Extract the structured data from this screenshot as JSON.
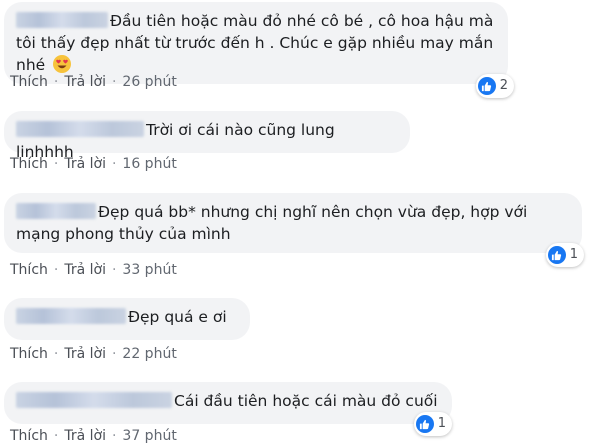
{
  "comments": [
    {
      "text": "Đầu tiên hoặc màu đỏ nhé cô bé , cô hoa hậu mà tôi thấy đẹp nhất từ trước đến h . Chúc e gặp nhiều may mắn nhé",
      "emoji": "heart-eyes-emoji",
      "like_label": "Thích",
      "reply_label": "Trả lời",
      "time": "26 phút",
      "reaction_count": "2"
    },
    {
      "text": "Trời ơi cái nào cũng lung linhhhh",
      "like_label": "Thích",
      "reply_label": "Trả lời",
      "time": "16 phút"
    },
    {
      "text": "Đẹp quá bb* nhưng chị nghĩ nên chọn vừa đẹp, hợp với mạng phong thủy của mình",
      "like_label": "Thích",
      "reply_label": "Trả lời",
      "time": "33 phút",
      "reaction_count": "1"
    },
    {
      "text": "Đẹp quá e ơi",
      "like_label": "Thích",
      "reply_label": "Trả lời",
      "time": "22 phút"
    },
    {
      "text": "Cái đầu tiên hoặc cái màu đỏ cuối",
      "like_label": "Thích",
      "reply_label": "Trả lời",
      "time": "37 phút",
      "reaction_count": "1"
    }
  ],
  "colors": {
    "bubble": "#f2f3f5",
    "like_blue": "#1877f2",
    "action_text": "#4b4f56"
  },
  "icons": {
    "reaction": "like-thumb-icon"
  }
}
